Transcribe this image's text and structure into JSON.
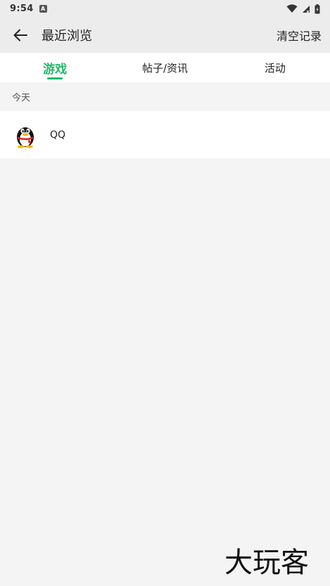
{
  "status_bar": {
    "time": "9:54",
    "notification_icon": "A"
  },
  "app_bar": {
    "title": "最近浏览",
    "clear_label": "清空记录"
  },
  "tabs": [
    {
      "label": "游戏",
      "active": true
    },
    {
      "label": "帖子/资讯",
      "active": false
    },
    {
      "label": "活动",
      "active": false
    }
  ],
  "sections": [
    {
      "header": "今天",
      "items": [
        {
          "name": "QQ",
          "icon": "qq-penguin-icon"
        }
      ]
    }
  ],
  "watermark": {
    "text": "大玩客"
  },
  "colors": {
    "accent": "#23b86c",
    "background": "#f4f4f4",
    "bar_background": "#ececec"
  }
}
